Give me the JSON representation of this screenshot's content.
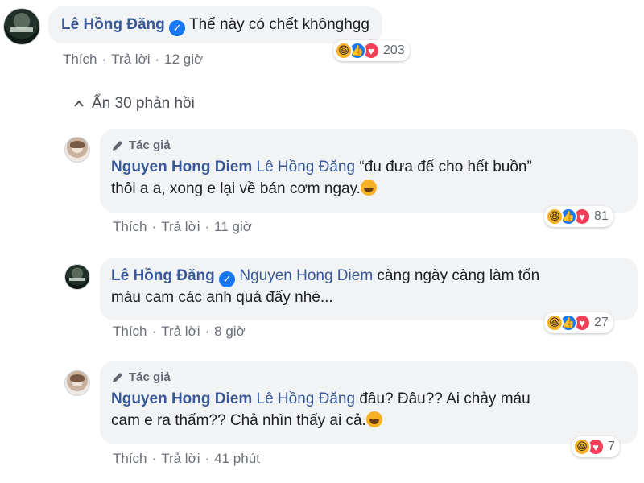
{
  "comments": [
    {
      "author": "Lê Hồng Đăng",
      "verified": true,
      "mention": "",
      "text": "Thế này có chết khônghgg",
      "like": "Thích",
      "reply": "Trả lời",
      "time": "12 giờ",
      "reaction_count": "203",
      "reactions": [
        "haha",
        "like",
        "love"
      ]
    }
  ],
  "hide_replies": {
    "label": "Ẩn 30 phản hồi",
    "icon": "chevron-up-icon"
  },
  "replies": [
    {
      "author_tag": "Tác giả",
      "author": "Nguyen Hong Diem",
      "verified": false,
      "mention": "Lê Hồng Đăng",
      "text_line1": " “đu đưa để cho hết buồn”",
      "text_line2": "thôi a a, xong e lại về bán cơm ngay.",
      "like": "Thích",
      "reply": "Trả lời",
      "time": "11 giờ",
      "reaction_count": "81",
      "reactions": [
        "haha",
        "like",
        "love"
      ]
    },
    {
      "author_tag": "",
      "author": "Lê Hồng Đăng",
      "verified": true,
      "mention": "Nguyen Hong Diem",
      "text_line1": " càng ngày càng làm tốn",
      "text_line2": "máu cam các anh quá đấy nhé...",
      "like": "Thích",
      "reply": "Trả lời",
      "time": "8 giờ",
      "reaction_count": "27",
      "reactions": [
        "haha",
        "like",
        "love"
      ]
    },
    {
      "author_tag": "Tác giả",
      "author": "Nguyen Hong Diem",
      "verified": false,
      "mention": "Lê Hồng Đăng",
      "text_line1": " đâu? Đâu?? Ai chảy máu",
      "text_line2": "cam e ra thấm?? Chả nhìn thấy ai cả.",
      "like": "Thích",
      "reply": "Trả lời",
      "time": "41 phút",
      "reaction_count": "7",
      "reactions": [
        "haha",
        "love"
      ]
    }
  ],
  "colors": {
    "link": "#385898",
    "bubble": "#f2f3f5",
    "meta": "#6b7078",
    "like": "#1877f2",
    "love": "#f33e58",
    "haha": "#f7b125"
  }
}
